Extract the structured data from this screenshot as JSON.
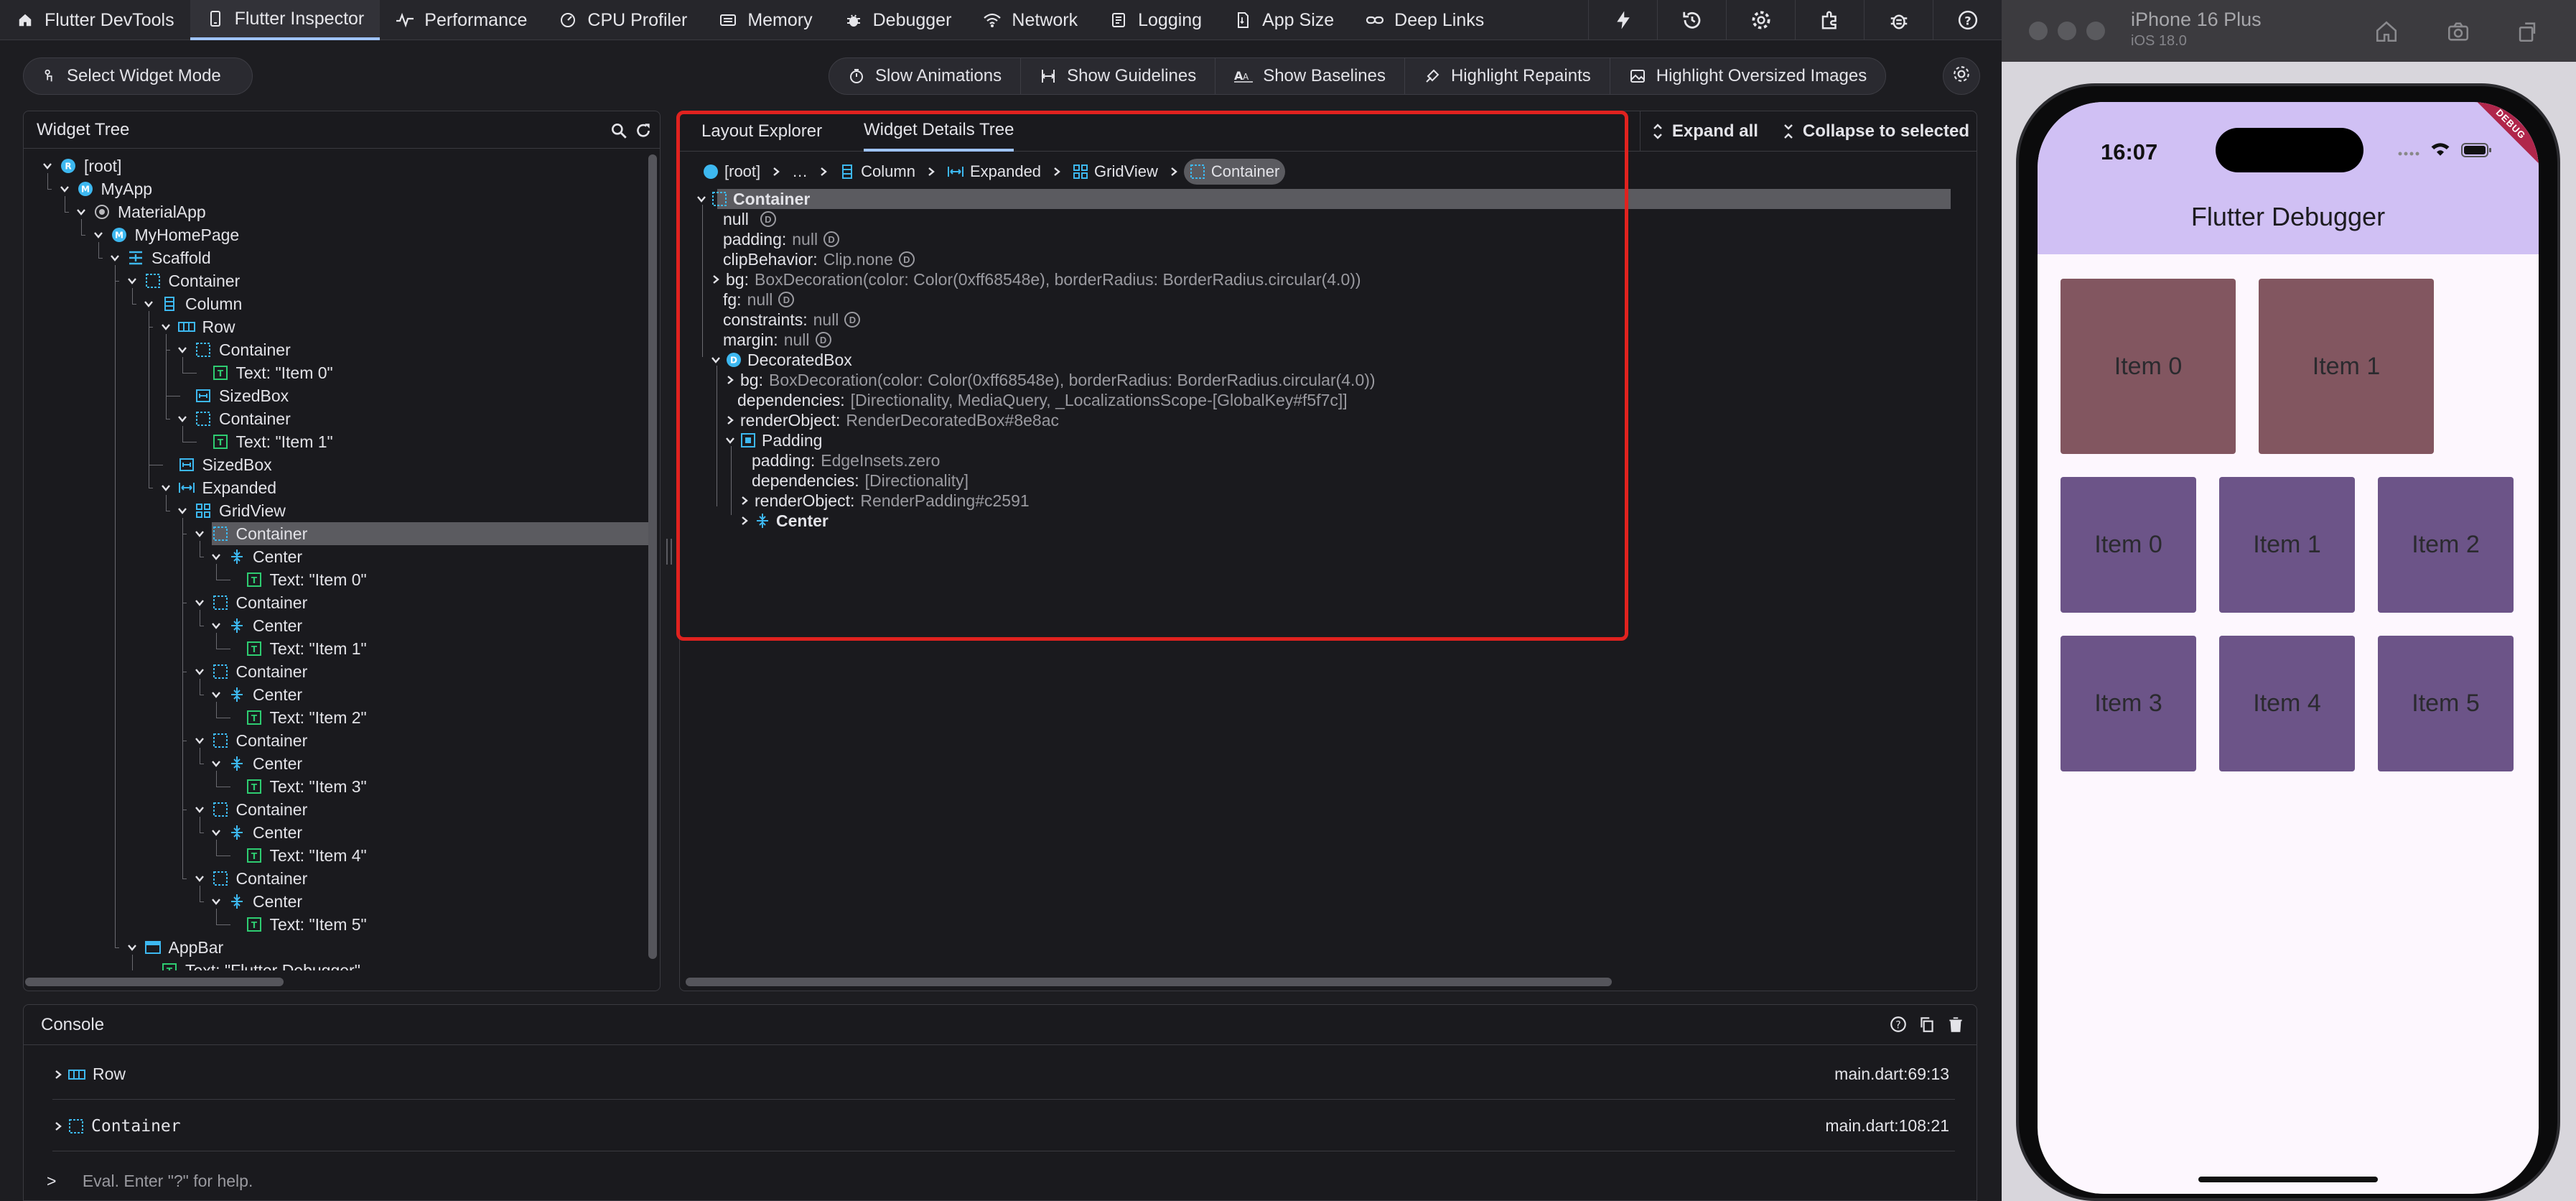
{
  "topbar": {
    "brand": "Flutter DevTools",
    "tabs": [
      {
        "label": "Flutter Inspector",
        "icon": "inspector-icon",
        "active": true
      },
      {
        "label": "Performance",
        "icon": "performance-icon"
      },
      {
        "label": "CPU Profiler",
        "icon": "cpu-icon"
      },
      {
        "label": "Memory",
        "icon": "memory-icon"
      },
      {
        "label": "Debugger",
        "icon": "bug-icon"
      },
      {
        "label": "Network",
        "icon": "wifi-icon"
      },
      {
        "label": "Logging",
        "icon": "logging-icon"
      },
      {
        "label": "App Size",
        "icon": "app-size-icon"
      },
      {
        "label": "Deep Links",
        "icon": "link-icon"
      }
    ],
    "right_icons": [
      "bolt-icon",
      "history-icon",
      "settings-icon",
      "extensions-icon",
      "bug-report-icon",
      "help-icon"
    ]
  },
  "toolbar": {
    "select_widget_mode": "Select Widget Mode",
    "toggles": [
      "Slow Animations",
      "Show Guidelines",
      "Show Baselines",
      "Highlight Repaints",
      "Highlight Oversized Images"
    ]
  },
  "widget_tree": {
    "title": "Widget Tree",
    "items": [
      {
        "label": "[root]",
        "depth": 0,
        "icon": "R",
        "kind": "circle-blue",
        "chev": true
      },
      {
        "label": "MyApp",
        "depth": 1,
        "icon": "M",
        "kind": "circle-blue",
        "chev": true
      },
      {
        "label": "MaterialApp",
        "depth": 2,
        "icon": "",
        "kind": "material",
        "chev": true
      },
      {
        "label": "MyHomePage",
        "depth": 3,
        "icon": "M",
        "kind": "circle-blue",
        "chev": true
      },
      {
        "label": "Scaffold",
        "depth": 4,
        "icon": "",
        "kind": "scaffold",
        "chev": true
      },
      {
        "label": "Container",
        "depth": 5,
        "icon": "",
        "kind": "container",
        "chev": true
      },
      {
        "label": "Column",
        "depth": 6,
        "icon": "",
        "kind": "column",
        "chev": true
      },
      {
        "label": "Row",
        "depth": 7,
        "icon": "",
        "kind": "row",
        "chev": true
      },
      {
        "label": "Container",
        "depth": 8,
        "icon": "",
        "kind": "container",
        "chev": true
      },
      {
        "label": "Text: \"Item 0\"",
        "depth": 9,
        "icon": "T",
        "kind": "text",
        "chev": false
      },
      {
        "label": "SizedBox",
        "depth": 8,
        "icon": "",
        "kind": "sizedbox",
        "chev": false
      },
      {
        "label": "Container",
        "depth": 8,
        "icon": "",
        "kind": "container",
        "chev": true
      },
      {
        "label": "Text: \"Item 1\"",
        "depth": 9,
        "icon": "T",
        "kind": "text",
        "chev": false
      },
      {
        "label": "SizedBox",
        "depth": 7,
        "icon": "",
        "kind": "sizedbox",
        "chev": false
      },
      {
        "label": "Expanded",
        "depth": 7,
        "icon": "",
        "kind": "expanded",
        "chev": true
      },
      {
        "label": "GridView",
        "depth": 8,
        "icon": "",
        "kind": "grid",
        "chev": true
      },
      {
        "label": "Container",
        "depth": 9,
        "icon": "",
        "kind": "container",
        "chev": true,
        "selected": true
      },
      {
        "label": "Center",
        "depth": 10,
        "icon": "",
        "kind": "center",
        "chev": true
      },
      {
        "label": "Text: \"Item 0\"",
        "depth": 11,
        "icon": "T",
        "kind": "text",
        "chev": false
      },
      {
        "label": "Container",
        "depth": 9,
        "icon": "",
        "kind": "container",
        "chev": true
      },
      {
        "label": "Center",
        "depth": 10,
        "icon": "",
        "kind": "center",
        "chev": true
      },
      {
        "label": "Text: \"Item 1\"",
        "depth": 11,
        "icon": "T",
        "kind": "text",
        "chev": false
      },
      {
        "label": "Container",
        "depth": 9,
        "icon": "",
        "kind": "container",
        "chev": true
      },
      {
        "label": "Center",
        "depth": 10,
        "icon": "",
        "kind": "center",
        "chev": true
      },
      {
        "label": "Text: \"Item 2\"",
        "depth": 11,
        "icon": "T",
        "kind": "text",
        "chev": false
      },
      {
        "label": "Container",
        "depth": 9,
        "icon": "",
        "kind": "container",
        "chev": true
      },
      {
        "label": "Center",
        "depth": 10,
        "icon": "",
        "kind": "center",
        "chev": true
      },
      {
        "label": "Text: \"Item 3\"",
        "depth": 11,
        "icon": "T",
        "kind": "text",
        "chev": false
      },
      {
        "label": "Container",
        "depth": 9,
        "icon": "",
        "kind": "container",
        "chev": true
      },
      {
        "label": "Center",
        "depth": 10,
        "icon": "",
        "kind": "center",
        "chev": true
      },
      {
        "label": "Text: \"Item 4\"",
        "depth": 11,
        "icon": "T",
        "kind": "text",
        "chev": false
      },
      {
        "label": "Container",
        "depth": 9,
        "icon": "",
        "kind": "container",
        "chev": true
      },
      {
        "label": "Center",
        "depth": 10,
        "icon": "",
        "kind": "center",
        "chev": true
      },
      {
        "label": "Text: \"Item 5\"",
        "depth": 11,
        "icon": "T",
        "kind": "text",
        "chev": false
      },
      {
        "label": "AppBar",
        "depth": 5,
        "icon": "",
        "kind": "appbar",
        "chev": true
      },
      {
        "label": "Text: \"Flutter Debugger\"",
        "depth": 6,
        "icon": "T",
        "kind": "text",
        "chev": false
      }
    ]
  },
  "details": {
    "tabs": [
      "Layout Explorer",
      "Widget Details Tree"
    ],
    "active_tab": "Widget Details Tree",
    "actions": [
      "Expand all",
      "Collapse to selected"
    ],
    "breadcrumb": [
      {
        "label": "[root]",
        "icon": "R"
      },
      {
        "label": "…",
        "icon": ""
      },
      {
        "label": "Column",
        "icon": "column"
      },
      {
        "label": "Expanded",
        "icon": "expanded"
      },
      {
        "label": "GridView",
        "icon": "grid"
      },
      {
        "label": "Container",
        "icon": "container",
        "active": true
      }
    ],
    "rows": [
      {
        "indent": 0,
        "chev": "down",
        "icon": "container",
        "key": "Container",
        "bold": true,
        "selected": true
      },
      {
        "indent": 1,
        "key": "null",
        "info": true
      },
      {
        "indent": 1,
        "key": "padding:",
        "value": "null",
        "info": true
      },
      {
        "indent": 1,
        "key": "clipBehavior:",
        "value": "Clip.none",
        "info": true
      },
      {
        "indent": 1,
        "chev": "right",
        "key": "bg:",
        "value": "BoxDecoration(color: Color(0xff68548e), borderRadius: BorderRadius.circular(4.0))"
      },
      {
        "indent": 1,
        "key": "fg:",
        "value": "null",
        "info": true
      },
      {
        "indent": 1,
        "key": "constraints:",
        "value": "null",
        "info": true
      },
      {
        "indent": 1,
        "key": "margin:",
        "value": "null",
        "info": true
      },
      {
        "indent": 1,
        "chev": "down",
        "icon": "D",
        "key": "DecoratedBox"
      },
      {
        "indent": 2,
        "chev": "right",
        "key": "bg:",
        "value": "BoxDecoration(color: Color(0xff68548e), borderRadius: BorderRadius.circular(4.0))"
      },
      {
        "indent": 2,
        "key": "dependencies:",
        "value": "[Directionality, MediaQuery, _LocalizationsScope-[GlobalKey#f5f7c]]"
      },
      {
        "indent": 2,
        "chev": "right",
        "key": "renderObject:",
        "value": "RenderDecoratedBox#8e8ac"
      },
      {
        "indent": 2,
        "chev": "down",
        "icon": "padding",
        "key": "Padding"
      },
      {
        "indent": 3,
        "key": "padding:",
        "value": "EdgeInsets.zero"
      },
      {
        "indent": 3,
        "key": "dependencies:",
        "value": "[Directionality]"
      },
      {
        "indent": 3,
        "chev": "right",
        "key": "renderObject:",
        "value": "RenderPadding#c2591"
      },
      {
        "indent": 3,
        "chev": "right",
        "icon": "center",
        "key": "Center",
        "bold": true
      }
    ]
  },
  "console": {
    "title": "Console",
    "entries": [
      {
        "label": "Row",
        "icon": "row",
        "location": "main.dart:69:13"
      },
      {
        "label": "Container",
        "icon": "container",
        "location": "main.dart:108:21"
      }
    ],
    "prompt": ">",
    "placeholder": "Eval. Enter \"?\" for help."
  },
  "simulator": {
    "device": "iPhone 16 Plus",
    "os": "iOS 18.0",
    "time": "16:07",
    "debug_banner": "DEBUG",
    "app_title": "Flutter Debugger",
    "row_items": [
      "Item 0",
      "Item 1"
    ],
    "grid_items": [
      "Item 0",
      "Item 1",
      "Item 2",
      "Item 3",
      "Item 4",
      "Item 5"
    ],
    "colors": {
      "appbar": "#d0c0f4",
      "row_tile": "#825660",
      "grid_tile": "#6c5488"
    }
  }
}
